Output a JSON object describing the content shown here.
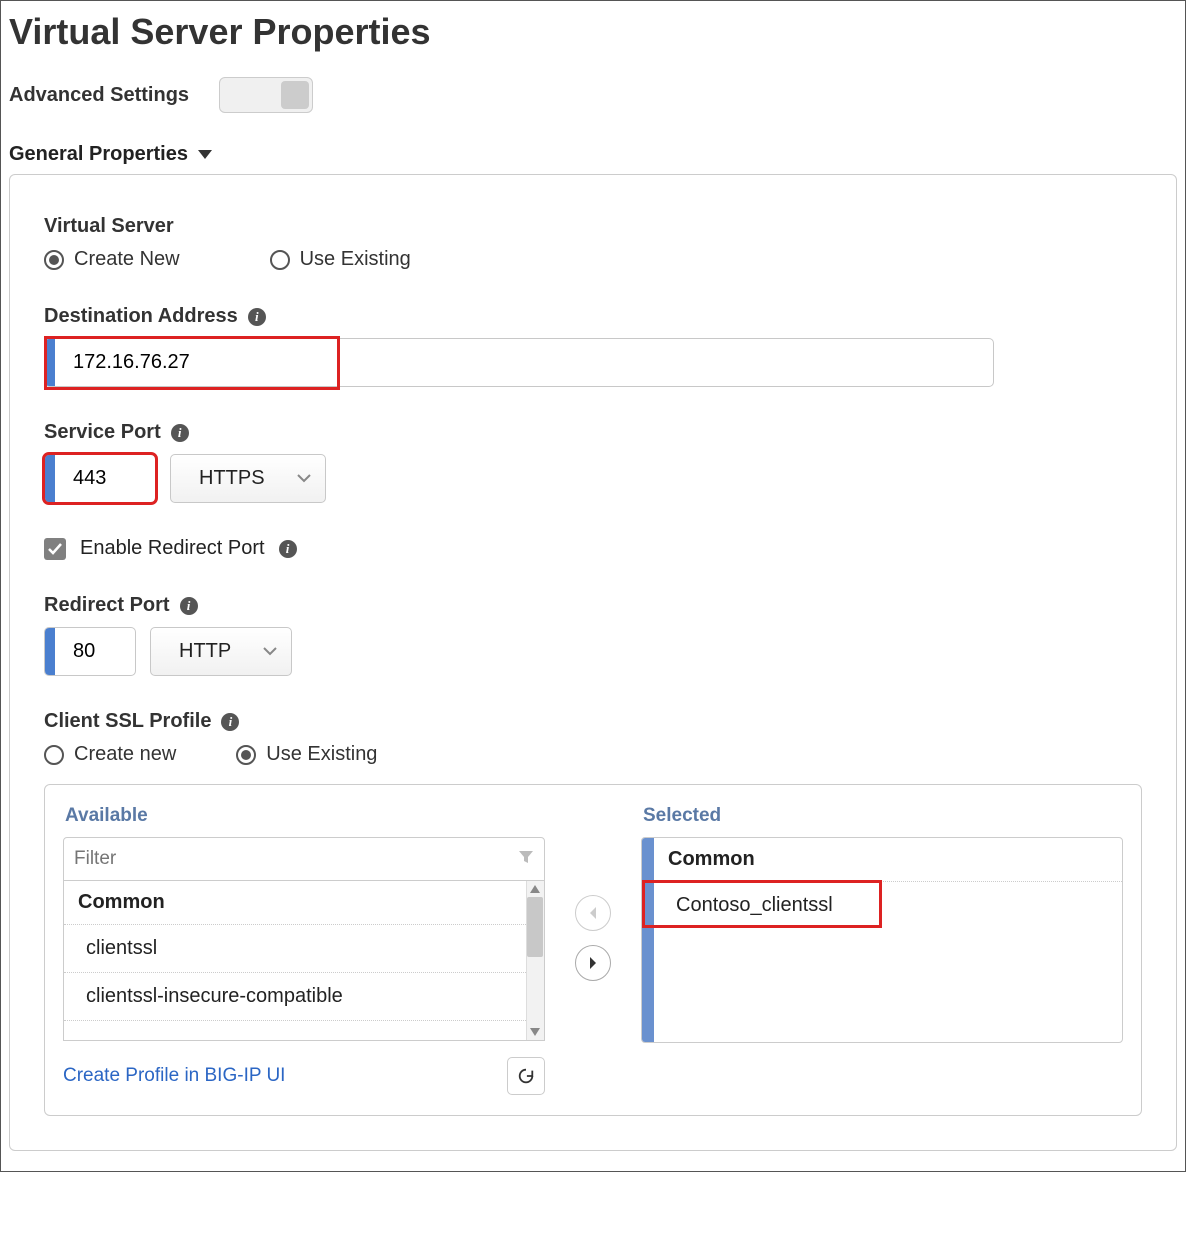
{
  "title": "Virtual Server Properties",
  "advanced_label": "Advanced Settings",
  "section_header": "General Properties",
  "virtual_server": {
    "label": "Virtual Server",
    "create_new": "Create New",
    "use_existing": "Use Existing"
  },
  "destination": {
    "label": "Destination Address",
    "value": "172.16.76.27"
  },
  "service_port": {
    "label": "Service Port",
    "value": "443",
    "protocol": "HTTPS"
  },
  "enable_redirect": {
    "label": "Enable Redirect Port"
  },
  "redirect_port": {
    "label": "Redirect Port",
    "value": "80",
    "protocol": "HTTP"
  },
  "client_ssl": {
    "label": "Client SSL Profile",
    "create_new": "Create new",
    "use_existing": "Use Existing"
  },
  "picker": {
    "available_label": "Available",
    "selected_label": "Selected",
    "filter_placeholder": "Filter",
    "avail_group": "Common",
    "avail_items": [
      "clientssl",
      "clientssl-insecure-compatible"
    ],
    "sel_group": "Common",
    "sel_items": [
      "Contoso_clientssl"
    ],
    "create_link": "Create Profile in BIG-IP UI"
  }
}
